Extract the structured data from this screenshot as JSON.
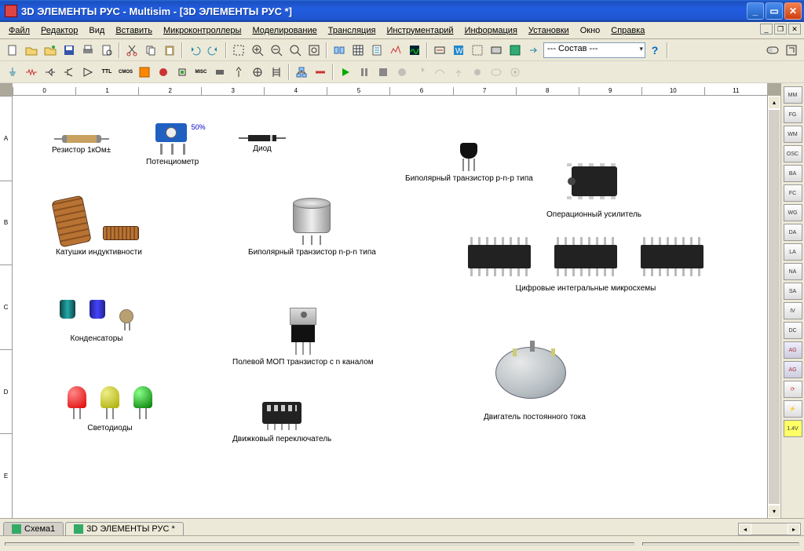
{
  "window": {
    "title": "3D ЭЛЕМЕНТЫ РУС - Multisim - [3D ЭЛЕМЕНТЫ РУС *]"
  },
  "menu": {
    "file": "Файл",
    "edit": "Редактор",
    "view": "Вид",
    "insert": "Вставить",
    "mcu": "Микроконтроллеры",
    "model": "Моделирование",
    "trans": "Трансляция",
    "instr": "Инструментарий",
    "info": "Информация",
    "setup": "Установки",
    "window": "Окно",
    "help": "Справка"
  },
  "toolbar": {
    "compose_combo": "--- Состав ---",
    "help_glyph": "?"
  },
  "ruler_h": [
    "0",
    "1",
    "2",
    "3",
    "4",
    "5",
    "6",
    "7",
    "8",
    "9",
    "10",
    "11"
  ],
  "ruler_v": [
    "A",
    "B",
    "C",
    "D",
    "E"
  ],
  "components": {
    "resistor": {
      "label": "Резистор 1кОм±",
      "value": ""
    },
    "pot": {
      "label": "Потенциометр",
      "percent": "50%"
    },
    "diode": {
      "label": "Диод"
    },
    "coils": {
      "label": "Катушки индуктивности"
    },
    "bjt_npn": {
      "label": "Биполярный транзистор n-p-n типа"
    },
    "bjt_pnp": {
      "label": "Биполярный транзистор p-n-p типа"
    },
    "opamp": {
      "label": "Операционный усилитель"
    },
    "caps": {
      "label": "Конденсаторы"
    },
    "mosfet": {
      "label": "Полевой МОП транзистор с n каналом"
    },
    "digital": {
      "label": "Цифровые интегральные микросхемы"
    },
    "leds": {
      "label": "Светодиоды"
    },
    "dipsw": {
      "label": "Движковый переключатель"
    },
    "motor": {
      "label": "Двигатель постоянного тока"
    }
  },
  "tabs": {
    "schema": "Схема1",
    "current": "3D ЭЛЕМЕНТЫ РУС *"
  },
  "right_instruments": [
    "MM",
    "FG",
    "WM",
    "OSC",
    "BA",
    "FC",
    "WG",
    "DA",
    "LA",
    "NA",
    "SA",
    "IV",
    "DC",
    "AG",
    "AG",
    "⟳",
    "⚡",
    "1.4V"
  ],
  "status": {
    "left": "",
    "right": ""
  }
}
